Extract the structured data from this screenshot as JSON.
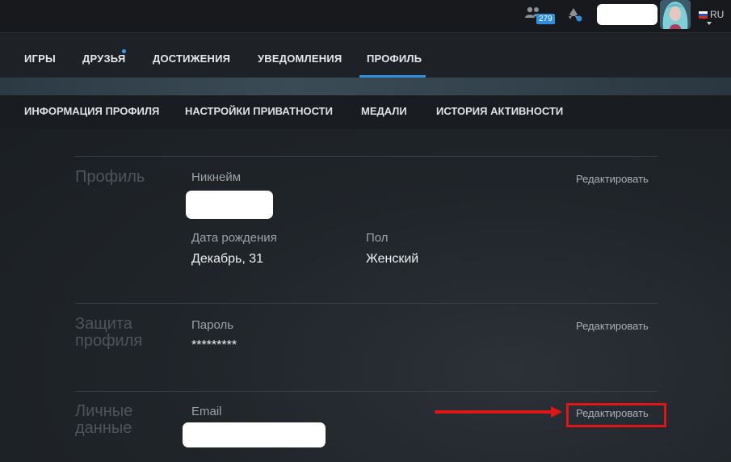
{
  "topbar": {
    "friends_count": "279",
    "language": "RU",
    "icons": [
      "friends-icon",
      "rocket-icon",
      "avatar",
      "flag-ru-icon",
      "chevron-down-icon"
    ]
  },
  "main_nav": {
    "items": [
      "ИГРЫ",
      "ДРУЗЬЯ",
      "ДОСТИЖЕНИЯ",
      "УВЕДОМЛЕНИЯ",
      "ПРОФИЛЬ"
    ],
    "active": "ПРОФИЛЬ",
    "accent_color": "#2f8fe0"
  },
  "sub_nav": {
    "items": [
      "ИНФОРМАЦИЯ ПРОФИЛЯ",
      "НАСТРОЙКИ ПРИВАТНОСТИ",
      "МЕДАЛИ",
      "ИСТОРИЯ АКТИВНОСТИ"
    ],
    "active": "ИНФОРМАЦИЯ ПРОФИЛЯ"
  },
  "sections": {
    "profile": {
      "title": "Профиль",
      "nickname_label": "Никнейм",
      "birth_label": "Дата рождения",
      "birth_value": "Декабрь, 31",
      "gender_label": "Пол",
      "gender_value": "Женский",
      "edit": "Редактировать"
    },
    "security": {
      "title_line1": "Защита",
      "title_line2": "профиля",
      "password_label": "Пароль",
      "password_value": "*********",
      "edit": "Редактировать"
    },
    "personal": {
      "title_line1": "Личные",
      "title_line2": "данные",
      "email_label": "Email",
      "edit": "Редактировать"
    }
  },
  "annotation_color": "#e01616"
}
